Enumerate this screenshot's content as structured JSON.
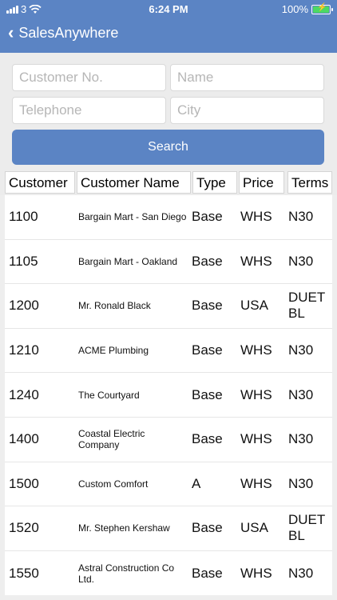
{
  "status": {
    "carrier": "3",
    "time": "6:24 PM",
    "battery": "100%",
    "battery_level": 1.0
  },
  "nav": {
    "back_icon": "chevron-left-icon",
    "title": "SalesAnywhere"
  },
  "search": {
    "customer_no_placeholder": "Customer No.",
    "name_placeholder": "Name",
    "telephone_placeholder": "Telephone",
    "city_placeholder": "City",
    "button_label": "Search"
  },
  "table": {
    "headers": [
      "Customer",
      "Customer Name",
      "Type",
      "Price",
      "Terms"
    ],
    "rows": [
      {
        "id": "1100",
        "name": "Bargain Mart - San Diego",
        "type": "Base",
        "price": "WHS",
        "terms": "N30"
      },
      {
        "id": "1105",
        "name": "Bargain Mart - Oakland",
        "type": "Base",
        "price": "WHS",
        "terms": "N30"
      },
      {
        "id": "1200",
        "name": "Mr. Ronald Black",
        "type": "Base",
        "price": "USA",
        "terms": "DUET BL"
      },
      {
        "id": "1210",
        "name": "ACME Plumbing",
        "type": "Base",
        "price": "WHS",
        "terms": "N30"
      },
      {
        "id": "1240",
        "name": "The Courtyard",
        "type": "Base",
        "price": "WHS",
        "terms": "N30"
      },
      {
        "id": "1400",
        "name": "Coastal Electric Company",
        "type": "Base",
        "price": "WHS",
        "terms": "N30"
      },
      {
        "id": "1500",
        "name": "Custom Comfort",
        "type": "A",
        "price": "WHS",
        "terms": "N30"
      },
      {
        "id": "1520",
        "name": "Mr. Stephen Kershaw",
        "type": "Base",
        "price": "USA",
        "terms": "DUET BL"
      },
      {
        "id": "1550",
        "name": "Astral Construction Co Ltd.",
        "type": "Base",
        "price": "WHS",
        "terms": "N30"
      }
    ]
  },
  "colors": {
    "accent": "#5b84c4",
    "background": "#eeeeee",
    "battery_fill": "#4cd964"
  }
}
